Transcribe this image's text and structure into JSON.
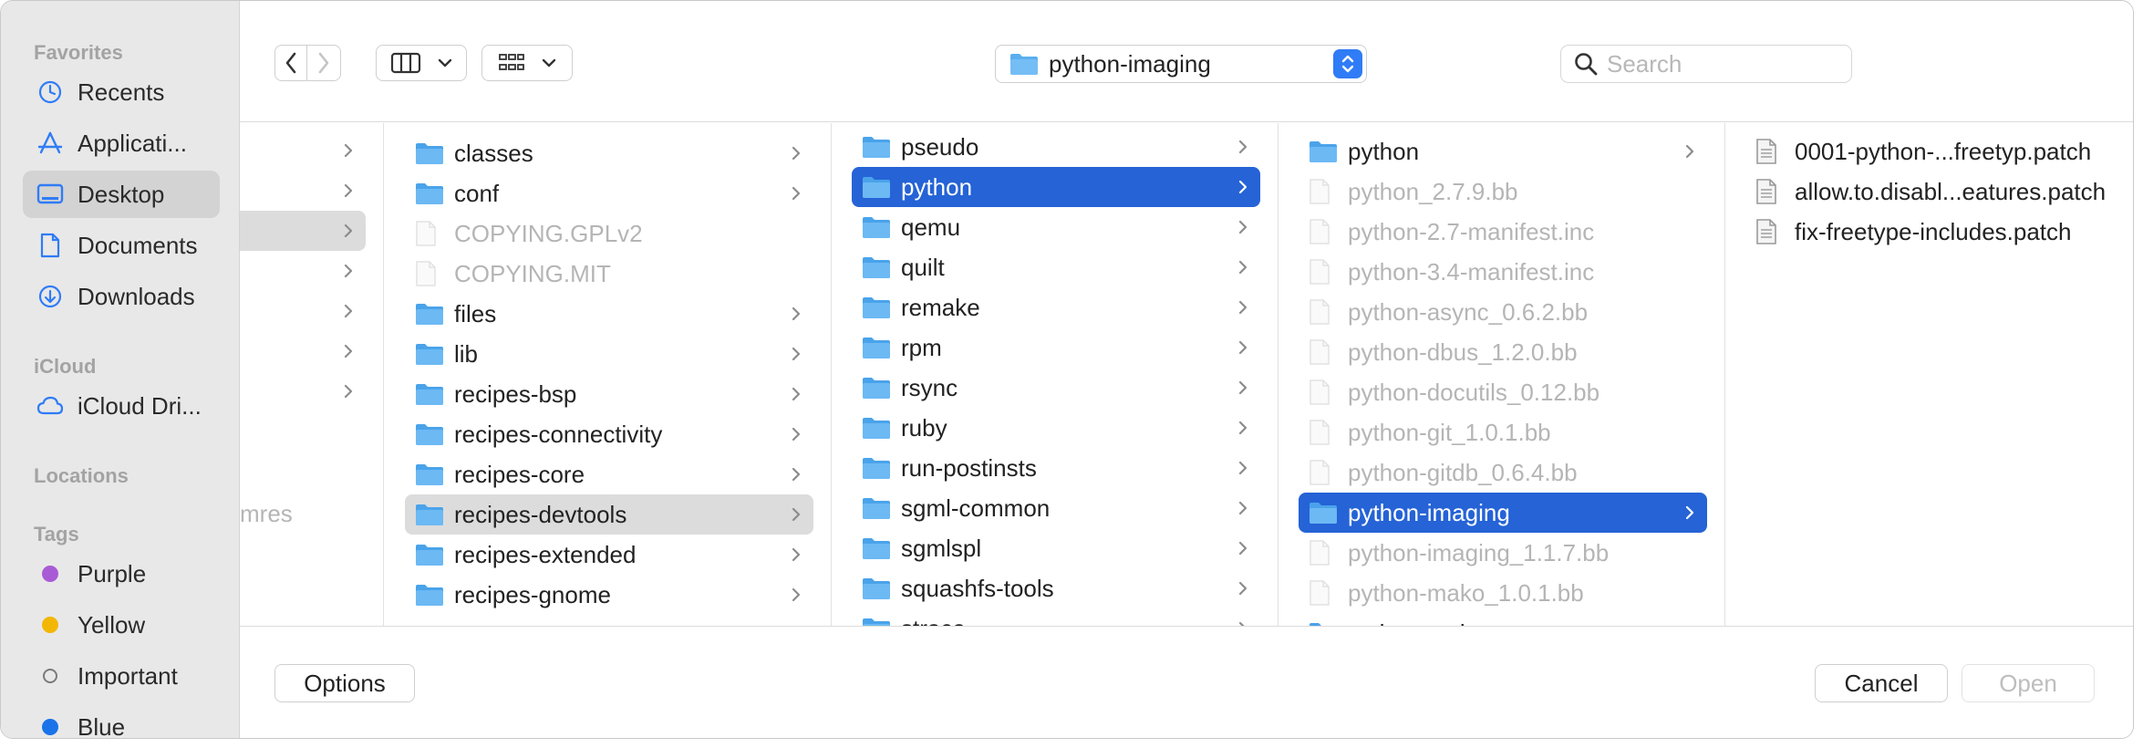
{
  "sidebar": {
    "sections": {
      "favorites": "Favorites",
      "icloud": "iCloud",
      "locations": "Locations",
      "tags": "Tags"
    },
    "favorites": [
      {
        "label": "Recents",
        "icon": "clock-icon"
      },
      {
        "label": "Applicati...",
        "icon": "applications-icon"
      },
      {
        "label": "Desktop",
        "icon": "desktop-icon",
        "selected": true
      },
      {
        "label": "Documents",
        "icon": "document-icon"
      },
      {
        "label": "Downloads",
        "icon": "download-icon"
      }
    ],
    "icloud": [
      {
        "label": "iCloud Dri...",
        "icon": "cloud-icon"
      }
    ],
    "tags": [
      {
        "label": "Purple",
        "color": "#a95bd6"
      },
      {
        "label": "Yellow",
        "color": "#f2b705"
      },
      {
        "label": "Important",
        "color": ""
      },
      {
        "label": "Blue",
        "color": "#1a73e8"
      }
    ]
  },
  "toolbar": {
    "path": "python-imaging",
    "search_placeholder": "Search"
  },
  "columns": {
    "col0_partial_text": "mres",
    "col1": [
      {
        "name": "classes",
        "type": "folder"
      },
      {
        "name": "conf",
        "type": "folder"
      },
      {
        "name": "COPYING.GPLv2",
        "type": "file"
      },
      {
        "name": "COPYING.MIT",
        "type": "file"
      },
      {
        "name": "files",
        "type": "folder"
      },
      {
        "name": "lib",
        "type": "folder"
      },
      {
        "name": "recipes-bsp",
        "type": "folder"
      },
      {
        "name": "recipes-connectivity",
        "type": "folder"
      },
      {
        "name": "recipes-core",
        "type": "folder"
      },
      {
        "name": "recipes-devtools",
        "type": "folder",
        "selected": "gray"
      },
      {
        "name": "recipes-extended",
        "type": "folder"
      },
      {
        "name": "recipes-gnome",
        "type": "folder"
      }
    ],
    "col2": [
      {
        "name": "pseudo",
        "type": "folder"
      },
      {
        "name": "python",
        "type": "folder",
        "selected": "blue"
      },
      {
        "name": "qemu",
        "type": "folder"
      },
      {
        "name": "quilt",
        "type": "folder"
      },
      {
        "name": "remake",
        "type": "folder"
      },
      {
        "name": "rpm",
        "type": "folder"
      },
      {
        "name": "rsync",
        "type": "folder"
      },
      {
        "name": "ruby",
        "type": "folder"
      },
      {
        "name": "run-postinsts",
        "type": "folder"
      },
      {
        "name": "sgml-common",
        "type": "folder"
      },
      {
        "name": "sgmlspl",
        "type": "folder"
      },
      {
        "name": "squashfs-tools",
        "type": "folder"
      },
      {
        "name": "strace",
        "type": "folder"
      }
    ],
    "col3": [
      {
        "name": "python",
        "type": "folder"
      },
      {
        "name": "python_2.7.9.bb",
        "type": "file"
      },
      {
        "name": "python-2.7-manifest.inc",
        "type": "file"
      },
      {
        "name": "python-3.4-manifest.inc",
        "type": "file"
      },
      {
        "name": "python-async_0.6.2.bb",
        "type": "file"
      },
      {
        "name": "python-dbus_1.2.0.bb",
        "type": "file"
      },
      {
        "name": "python-docutils_0.12.bb",
        "type": "file"
      },
      {
        "name": "python-git_1.0.1.bb",
        "type": "file"
      },
      {
        "name": "python-gitdb_0.6.4.bb",
        "type": "file"
      },
      {
        "name": "python-imaging",
        "type": "folder",
        "selected": "blue"
      },
      {
        "name": "python-imaging_1.1.7.bb",
        "type": "file"
      },
      {
        "name": "python-mako_1.0.1.bb",
        "type": "file"
      },
      {
        "name": "python-native",
        "type": "folder"
      }
    ],
    "col4": [
      {
        "name": "0001-python-...freetyp.patch",
        "type": "patch"
      },
      {
        "name": "allow.to.disabl...eatures.patch",
        "type": "patch"
      },
      {
        "name": "fix-freetype-includes.patch",
        "type": "patch"
      }
    ]
  },
  "bottom": {
    "options_label": "Options",
    "cancel_label": "Cancel",
    "open_label": "Open"
  },
  "colors": {
    "accent": "#2563d6",
    "folder": "#5aaef0",
    "sidebar_icon": "#2f7cf6"
  }
}
